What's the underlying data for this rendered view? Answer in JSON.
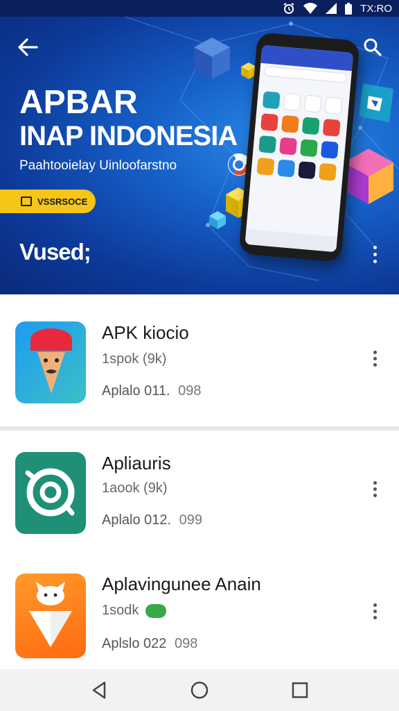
{
  "status_bar": {
    "time": "TX:RO",
    "icons": [
      "alarm-icon",
      "wifi-icon",
      "signal-icon",
      "battery-icon"
    ]
  },
  "hero": {
    "title_line1": "APBAR",
    "title_line2": "INAP INDONESIA",
    "subtitle": "Paahtooielay Uinloofarstno",
    "badge_label": "VSSRSOCE",
    "section_label": "Vused;",
    "accent_color": "#f5c518",
    "background_color": "#1660c8"
  },
  "apps": [
    {
      "name": "APK kiocio",
      "size": "1spok (9k)",
      "version": "Aplalo 011.",
      "version_suffix": "098",
      "icon": "character-face-icon",
      "icon_colors": [
        "#e84a6a",
        "#1e9bf0",
        "#3bc0c8"
      ]
    },
    {
      "name": "Apliauris",
      "size": "1aook (9k)",
      "version": "Aplalo 012.",
      "version_suffix": "099",
      "icon": "swirl-logo-icon",
      "icon_colors": [
        "#1f8f78",
        "#ffffff"
      ]
    },
    {
      "name": "Aplavingunee Anain",
      "size": "1sodk",
      "version": "Aplslo 022",
      "version_suffix": "098",
      "icon": "fox-cone-icon",
      "icon_colors": [
        "#ff7a1a",
        "#ffffff"
      ]
    }
  ],
  "nav": {
    "buttons": [
      "back-triangle-icon",
      "home-circle-icon",
      "recents-square-icon"
    ]
  }
}
